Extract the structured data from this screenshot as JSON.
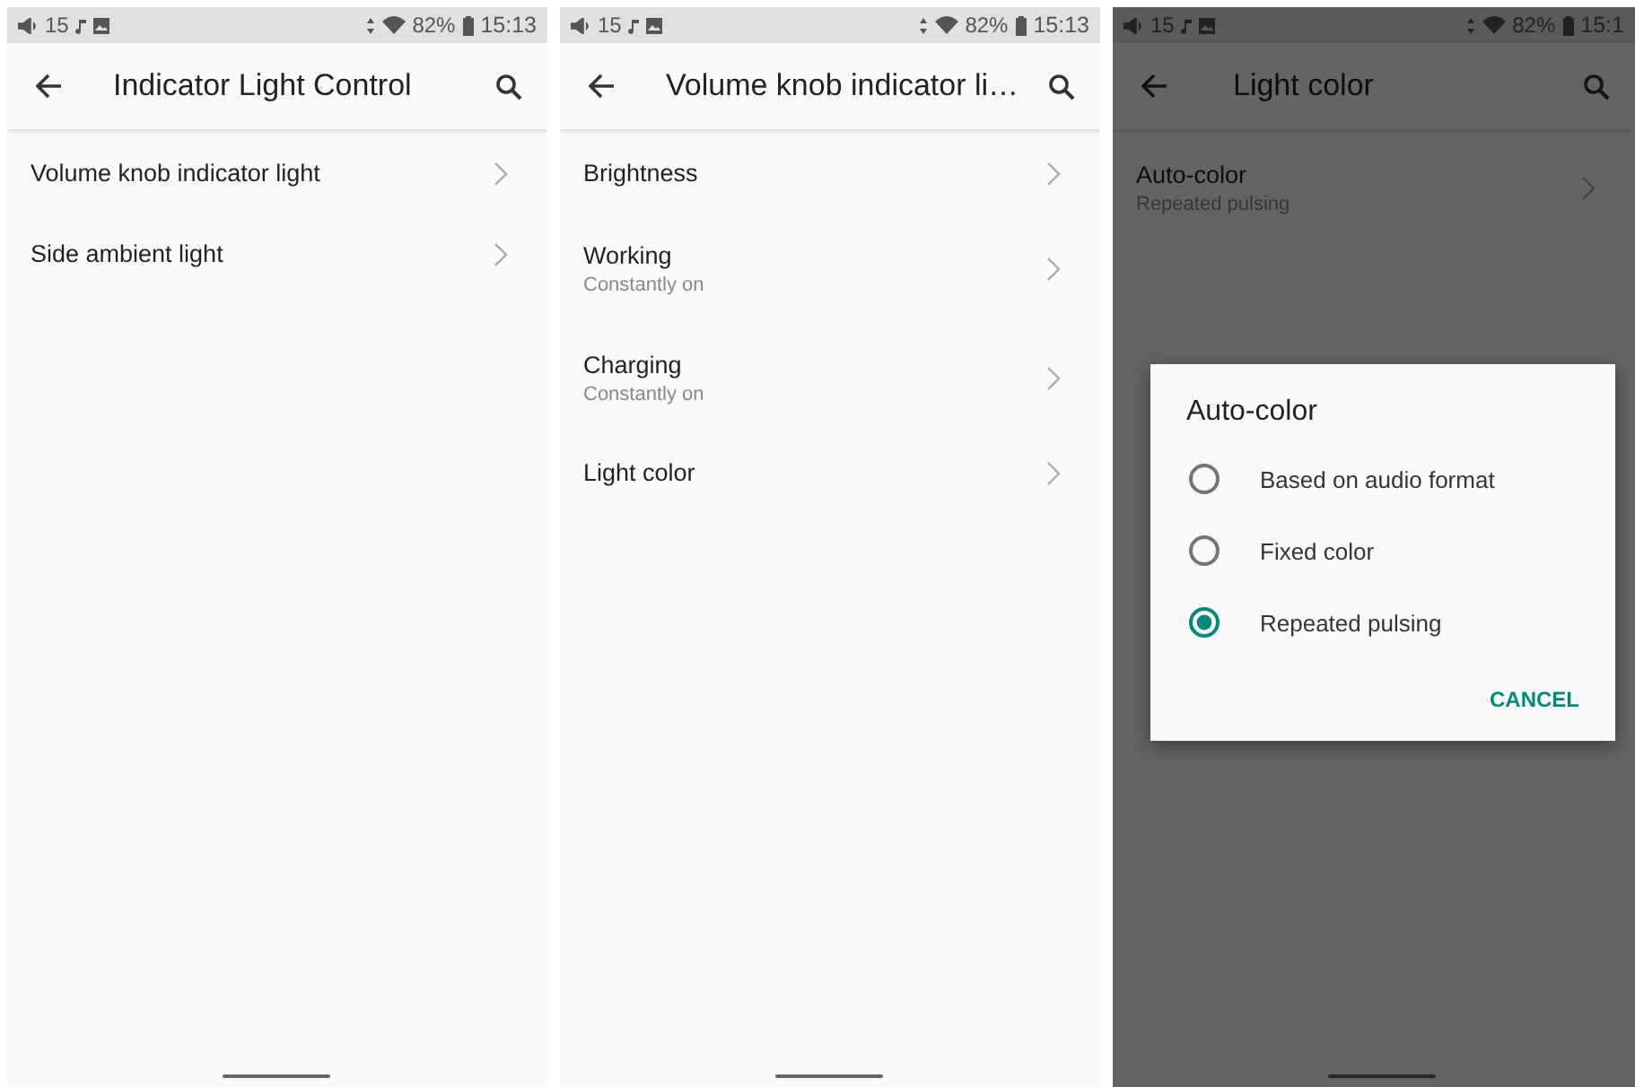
{
  "screens": [
    {
      "status": {
        "volume": "15",
        "battery": "82%",
        "time": "15:13"
      },
      "title": "Indicator Light Control",
      "dimmed": false,
      "items": [
        {
          "title": "Volume knob indicator light"
        },
        {
          "title": "Side ambient light"
        }
      ]
    },
    {
      "status": {
        "volume": "15",
        "battery": "82%",
        "time": "15:13"
      },
      "title": "Volume knob indicator li…",
      "dimmed": false,
      "items": [
        {
          "title": "Brightness"
        },
        {
          "title": "Working",
          "subtitle": "Constantly on"
        },
        {
          "title": "Charging",
          "subtitle": "Constantly on"
        },
        {
          "title": "Light color"
        }
      ]
    },
    {
      "status": {
        "volume": "15",
        "battery": "82%",
        "time": "15:1"
      },
      "title": "Light color",
      "dimmed": true,
      "items": [
        {
          "title": "Auto-color",
          "subtitle": "Repeated pulsing"
        }
      ],
      "dialog": {
        "title": "Auto-color",
        "options": [
          {
            "label": "Based on audio format",
            "selected": false
          },
          {
            "label": "Fixed color",
            "selected": false
          },
          {
            "label": "Repeated pulsing",
            "selected": true
          }
        ],
        "button": "CANCEL"
      }
    }
  ]
}
